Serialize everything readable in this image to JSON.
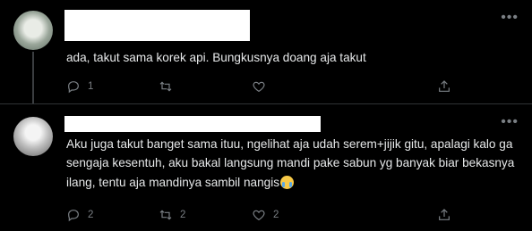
{
  "tweets": [
    {
      "text": "ada, takut sama korek api. Bungkusnya doang aja takut",
      "more_icon": "•••",
      "reply_count": "1",
      "retweet_count": "",
      "like_count": ""
    },
    {
      "text": "Aku juga takut banget sama ituu, ngelihat aja udah serem+jijik gitu, apalagi kalo ga sengaja kesentuh, aku bakal langsung mandi pake sabun yg banyak biar bekasnya ilang, tentu aja mandinya sambil nangis",
      "more_icon": "•••",
      "reply_count": "2",
      "retweet_count": "2",
      "like_count": "2"
    }
  ],
  "icons": {
    "reply": "reply-icon",
    "retweet": "retweet-icon",
    "like": "heart-icon",
    "share": "share-icon",
    "emoji": "loudly-crying-face-emoji"
  }
}
